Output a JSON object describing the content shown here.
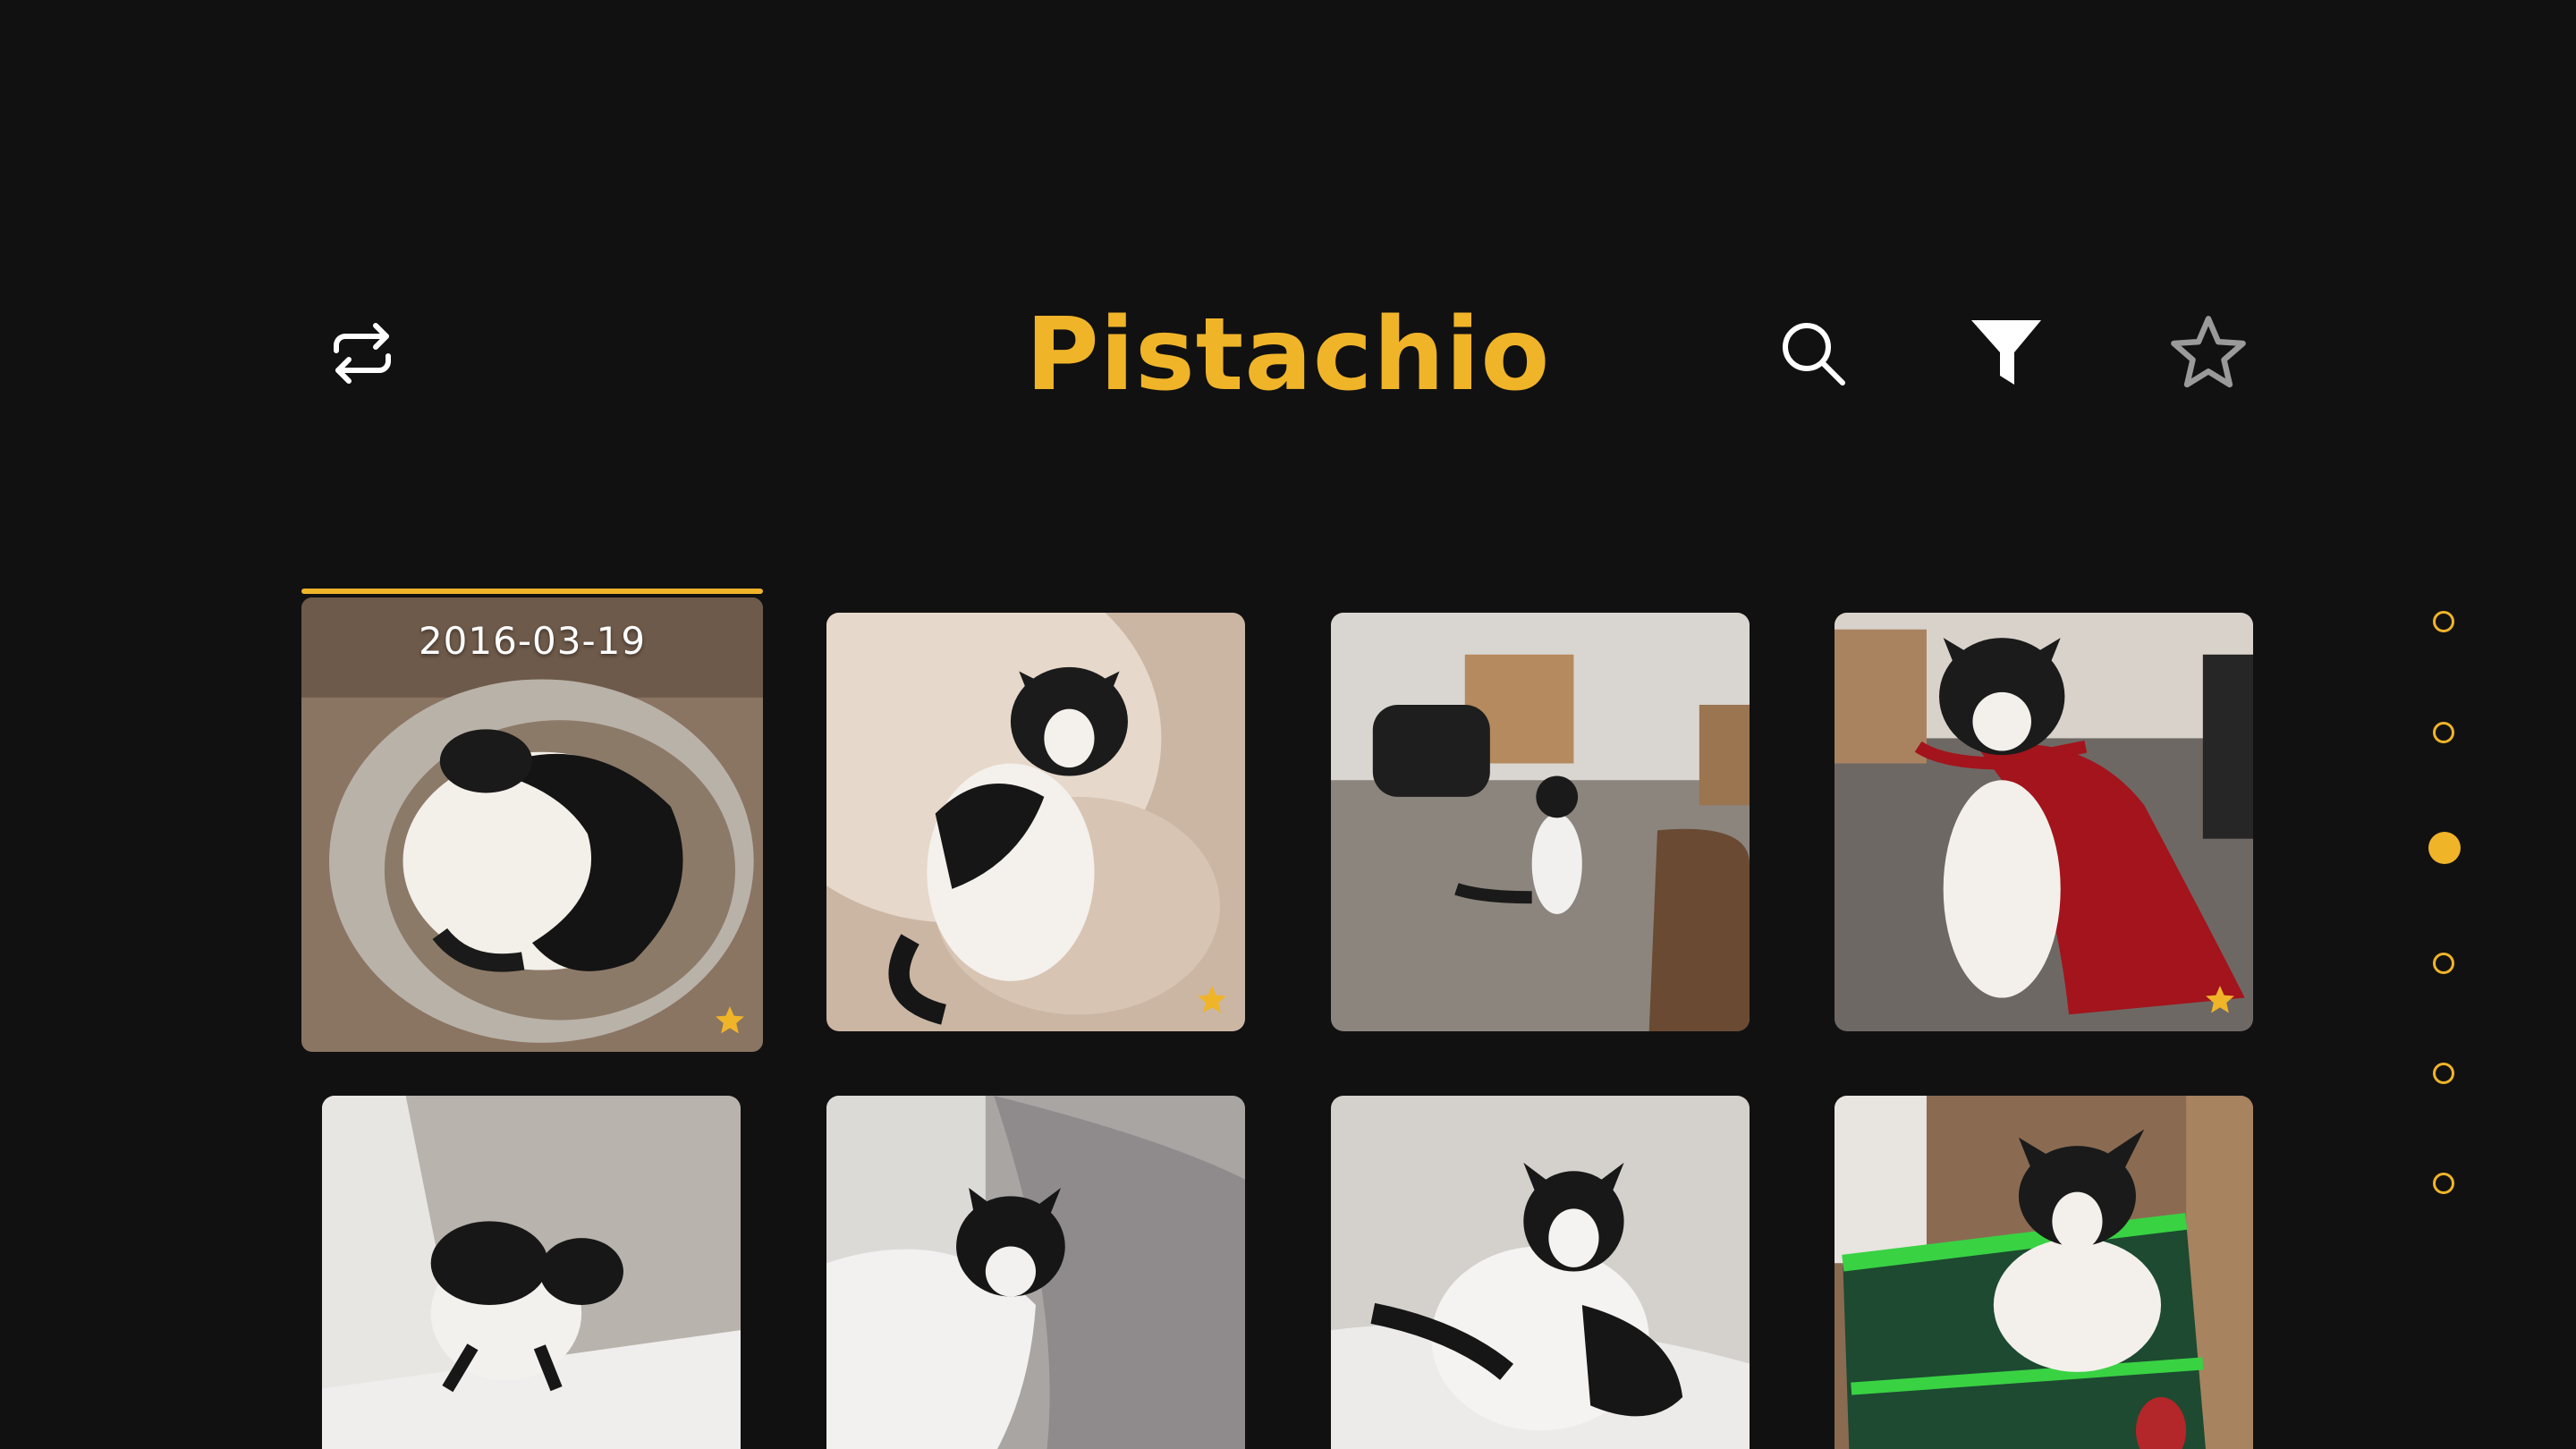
{
  "app": {
    "title": "Pistachio"
  },
  "header": {
    "icons": {
      "repeat": "repeat-icon",
      "search": "search-icon",
      "filter": "filter-icon",
      "favorites": "star-outline-icon"
    }
  },
  "colors": {
    "accent": "#f0b429",
    "background": "#111112",
    "icon_light": "#ffffff",
    "icon_gray": "#9a9a9a"
  },
  "grid": {
    "focused_date": "2016-03-19",
    "photos": [
      {
        "subject": "cat curled up sleeping in a round bed",
        "favorite": true,
        "focused": true
      },
      {
        "subject": "cat lying on a washing machine drum",
        "favorite": true
      },
      {
        "subject": "cat standing on hind legs in a room with boxes",
        "favorite": false
      },
      {
        "subject": "cat wearing a red cape",
        "favorite": true
      },
      {
        "subject": "cat crouching on a white ledge",
        "favorite": false
      },
      {
        "subject": "cat resting on a white blanket",
        "favorite": false
      },
      {
        "subject": "cat lounging on a bed",
        "favorite": false
      },
      {
        "subject": "cat sitting in a green toy basket",
        "favorite": false
      }
    ]
  },
  "page_indicator": {
    "count": 6,
    "active": 3
  }
}
